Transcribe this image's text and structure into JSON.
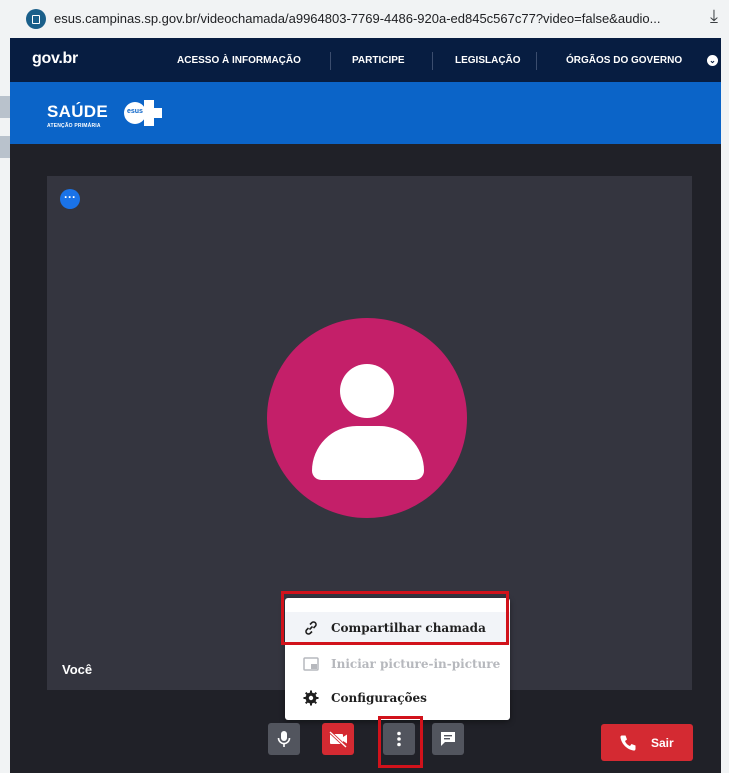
{
  "browser": {
    "url": "esus.campinas.sp.gov.br/videochamada/a9964803-7769-4486-920a-ed845c567c77?video=false&audio...",
    "reader_icon": "reader-mode-icon",
    "download_icon": "download-icon"
  },
  "gov_bar": {
    "logo": "gov.br",
    "nav": [
      "ACESSO À INFORMAÇÃO",
      "PARTICIPE",
      "LEGISLAÇÃO",
      "ÓRGÃOS DO GOVERNO"
    ],
    "color": "#071d41"
  },
  "banner": {
    "title": "SAÚDE",
    "subtitle": "ATENÇÃO PRIMÁRIA",
    "badge": "esus",
    "color": "#0b64c8"
  },
  "video": {
    "participant_label": "Você",
    "more_options_icon": "ellipsis-icon",
    "avatar_color": "#c41f69"
  },
  "menu": {
    "items": [
      {
        "label": "Compartilhar chamada",
        "icon": "link-icon",
        "enabled": true
      },
      {
        "label": "Iniciar picture-in-picture",
        "icon": "picture-in-picture-icon",
        "enabled": false
      },
      {
        "label": "Configurações",
        "icon": "gear-icon",
        "enabled": true
      }
    ]
  },
  "controls": {
    "mic_icon": "microphone-icon",
    "camera_icon": "camera-off-icon",
    "more_icon": "vertical-dots-icon",
    "chat_icon": "chat-icon",
    "leave_label": "Sair",
    "leave_color": "#d42a32"
  },
  "highlight_color": "#d1121b"
}
